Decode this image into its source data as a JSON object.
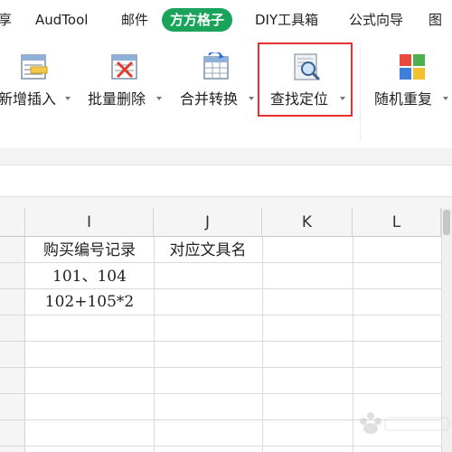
{
  "menu": {
    "tabs": [
      {
        "label": "享"
      },
      {
        "label": "AudTool"
      },
      {
        "label": "邮件"
      },
      {
        "label": "方方格子",
        "active": true
      },
      {
        "label": "DIY工具箱"
      },
      {
        "label": "公式向导"
      },
      {
        "label": "图"
      }
    ],
    "active_color": "#1aa35a"
  },
  "ribbon": {
    "buttons": [
      {
        "label": "新增插入",
        "icon": "insert-rows-icon"
      },
      {
        "label": "批量删除",
        "icon": "delete-rows-icon"
      },
      {
        "label": "合并转换",
        "icon": "merge-convert-icon"
      },
      {
        "label": "查找定位",
        "icon": "find-locate-icon",
        "highlighted": true
      },
      {
        "label": "随机重复",
        "icon": "random-repeat-icon"
      }
    ],
    "highlight_color": "#e8302f"
  },
  "sheet": {
    "columns": [
      "I",
      "J",
      "K",
      "L"
    ],
    "rows": [
      [
        "购买编号记录",
        "对应文具名",
        "",
        ""
      ],
      [
        "101、104",
        "",
        "",
        ""
      ],
      [
        "102+105*2",
        "",
        "",
        ""
      ]
    ]
  }
}
